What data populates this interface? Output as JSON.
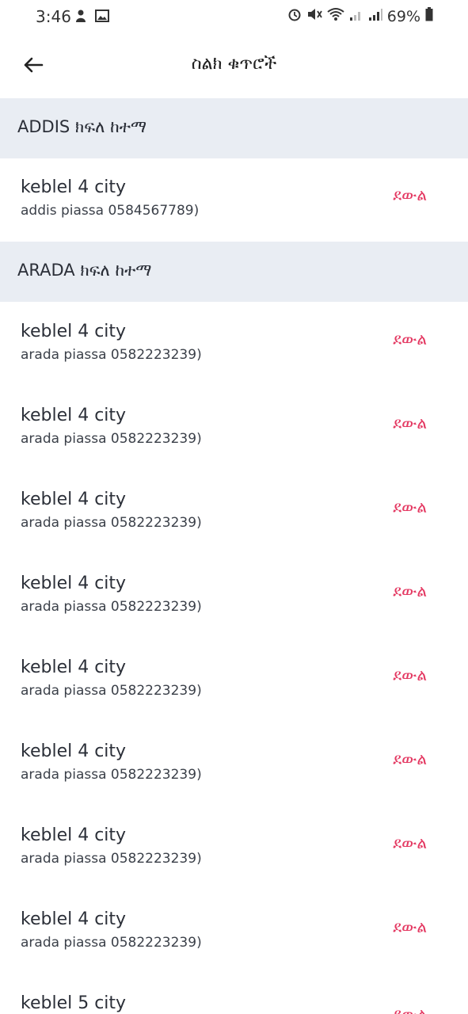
{
  "status_bar": {
    "time": "3:46",
    "battery": "69%"
  },
  "app_bar": {
    "title": "ስልክ ቁጥሮች"
  },
  "sections": [
    {
      "title": "ADDIS ክፍለ ከተማ",
      "items": [
        {
          "title": "keblel 4 city",
          "subtitle": "addis piassa 0584567789)",
          "action": "ደውል"
        }
      ]
    },
    {
      "title": "ARADA ክፍለ ከተማ",
      "items": [
        {
          "title": "keblel 4 city",
          "subtitle": "arada piassa 0582223239)",
          "action": "ደውል"
        },
        {
          "title": "keblel 4 city",
          "subtitle": "arada piassa 0582223239)",
          "action": "ደውል"
        },
        {
          "title": "keblel 4 city",
          "subtitle": "arada piassa 0582223239)",
          "action": "ደውል"
        },
        {
          "title": "keblel 4 city",
          "subtitle": "arada piassa 0582223239)",
          "action": "ደውል"
        },
        {
          "title": "keblel 4 city",
          "subtitle": "arada piassa 0582223239)",
          "action": "ደውል"
        },
        {
          "title": "keblel 4 city",
          "subtitle": "arada piassa 0582223239)",
          "action": "ደውል"
        },
        {
          "title": "keblel 4 city",
          "subtitle": "arada piassa 0582223239)",
          "action": "ደውል"
        },
        {
          "title": "keblel 4 city",
          "subtitle": "arada piassa 0582223239)",
          "action": "ደውል"
        },
        {
          "title": "keblel 5 city",
          "subtitle": "",
          "action": "ደውል"
        }
      ]
    }
  ],
  "colors": {
    "accent": "#e43a63",
    "section_bg": "#e9edf3"
  }
}
